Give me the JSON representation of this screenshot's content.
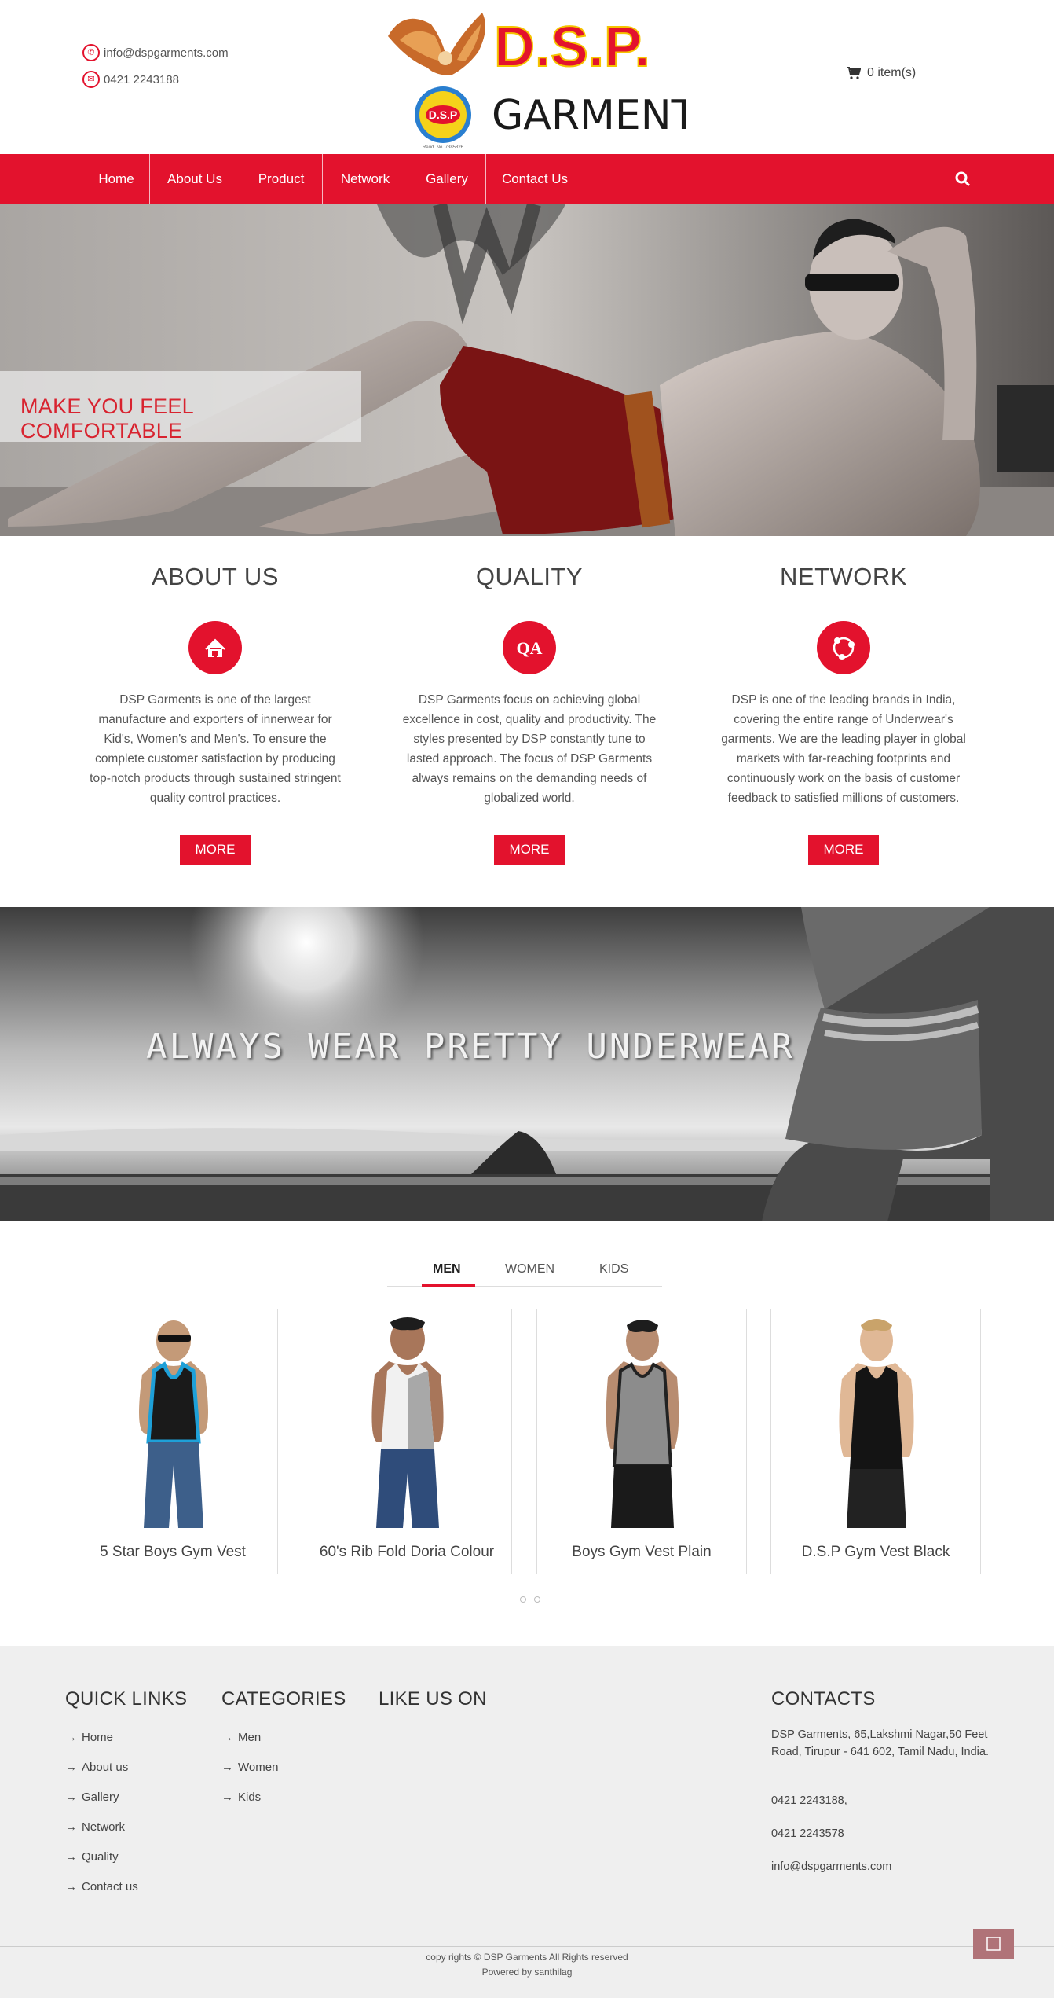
{
  "header": {
    "email": "info@dspgarments.com",
    "phone": "0421 2243188",
    "logo_top": "D.S.P.",
    "logo_bottom": "GARMENTS",
    "cart": "0 item(s)"
  },
  "nav": {
    "items": [
      {
        "label": "Home"
      },
      {
        "label": "About Us"
      },
      {
        "label": "Product"
      },
      {
        "label": "Network"
      },
      {
        "label": "Gallery"
      },
      {
        "label": "Contact Us"
      }
    ]
  },
  "hero": {
    "caption": "MAKE YOU FEEL COMFORTABLE"
  },
  "features": [
    {
      "title": "ABOUT US",
      "icon": "home-icon",
      "text": "DSP Garments is one of the largest manufacture and exporters of innerwear for Kid's, Women's and Men's. To ensure the complete customer satisfaction by producing top-notch products through sustained stringent quality control practices.",
      "button": "MORE"
    },
    {
      "title": "QUALITY",
      "icon": "qa-icon",
      "text": "DSP Garments focus on achieving global excellence in cost, quality and productivity. The styles presented by DSP constantly tune to lasted approach. The focus of DSP Garments always remains on the demanding needs of globalized world.",
      "button": "MORE"
    },
    {
      "title": "NETWORK",
      "icon": "network-icon",
      "text": "DSP is one of the leading brands in India, covering the entire range of Underwear's garments. We are the leading player in global markets with far-reaching footprints and continuously work on the basis of customer feedback to satisfied millions of customers.",
      "button": "MORE"
    }
  ],
  "banner": {
    "text": "ALWAYS WEAR PRETTY UNDERWEAR"
  },
  "tabs": [
    {
      "label": "MEN",
      "active": true
    },
    {
      "label": "WOMEN",
      "active": false
    },
    {
      "label": "KIDS",
      "active": false
    }
  ],
  "products": [
    {
      "name": "5 Star Boys Gym Vest"
    },
    {
      "name": "60's Rib Fold Doria Colour"
    },
    {
      "name": "Boys Gym Vest Plain"
    },
    {
      "name": "D.S.P Gym Vest Black"
    }
  ],
  "footer": {
    "quick_links_title": "QUICK LINKS",
    "quick_links": [
      "Home",
      "About us",
      "Gallery",
      "Network",
      "Quality",
      "Contact us"
    ],
    "categories_title": "CATEGORIES",
    "categories": [
      "Men",
      "Women",
      "Kids"
    ],
    "like_title": "LIKE US ON",
    "contacts_title": "CONTACTS",
    "address": "DSP Garments, 65,Lakshmi Nagar,50 Feet Road, Tirupur - 641 602, Tamil Nadu, India.",
    "phone1": "0421 2243188,",
    "phone2": "0421 2243578",
    "email": "info@dspgarments.com",
    "copyright": "copy rights © DSP Garments All Rights reserved",
    "powered": "Powered by santhilag"
  },
  "colors": {
    "brand_red": "#e3122d",
    "footer_bg": "#efefef"
  }
}
